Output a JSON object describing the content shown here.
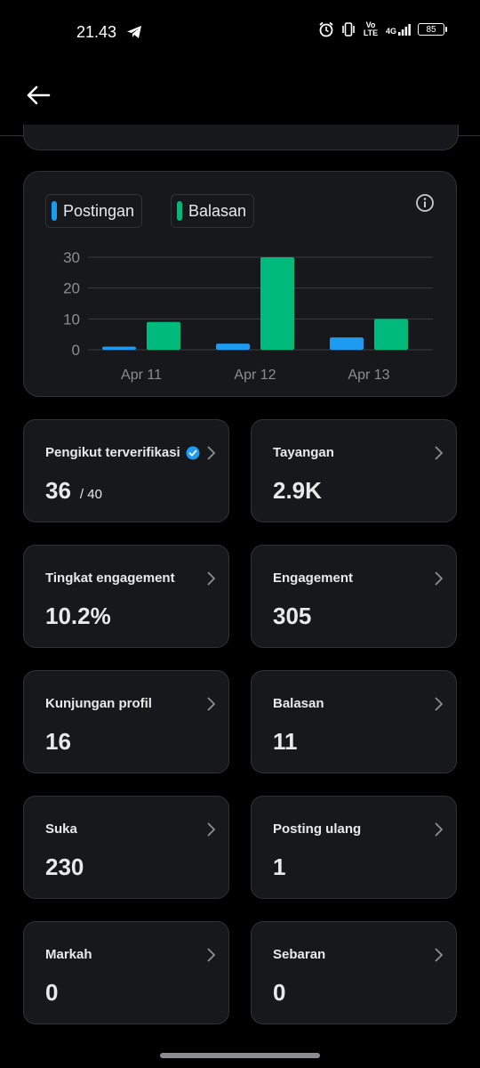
{
  "status_bar": {
    "time": "21.43",
    "network_volte": "Vo LTE",
    "network_4g": "4G",
    "battery": "85"
  },
  "chart": {
    "legend": [
      {
        "label": "Postingan",
        "color": "#1d9bf0"
      },
      {
        "label": "Balasan",
        "color": "#00ba7c"
      }
    ]
  },
  "chart_data": {
    "type": "bar",
    "categories": [
      "Apr 11",
      "Apr 12",
      "Apr 13"
    ],
    "series": [
      {
        "name": "Postingan",
        "color": "#1d9bf0",
        "values": [
          1,
          2,
          4
        ]
      },
      {
        "name": "Balasan",
        "color": "#00ba7c",
        "values": [
          9,
          30,
          10
        ]
      }
    ],
    "yticks": [
      0,
      10,
      20,
      30
    ],
    "ylim": [
      0,
      30
    ],
    "grid": true,
    "legend": "top-left"
  },
  "stats": [
    {
      "label": "Pengikut terverifikasi",
      "value": "36",
      "sub": "/ 40",
      "verified": true
    },
    {
      "label": "Tayangan",
      "value": "2.9K"
    },
    {
      "label": "Tingkat engagement",
      "value": "10.2%"
    },
    {
      "label": "Engagement",
      "value": "305"
    },
    {
      "label": "Kunjungan profil",
      "value": "16"
    },
    {
      "label": "Balasan",
      "value": "11"
    },
    {
      "label": "Suka",
      "value": "230"
    },
    {
      "label": "Posting ulang",
      "value": "1"
    },
    {
      "label": "Markah",
      "value": "0"
    },
    {
      "label": "Sebaran",
      "value": "0"
    }
  ],
  "icons": {
    "back": "arrow-left-icon",
    "info": "info-icon",
    "chevron": "chevron-right-icon",
    "verified": "verified-badge-icon"
  }
}
